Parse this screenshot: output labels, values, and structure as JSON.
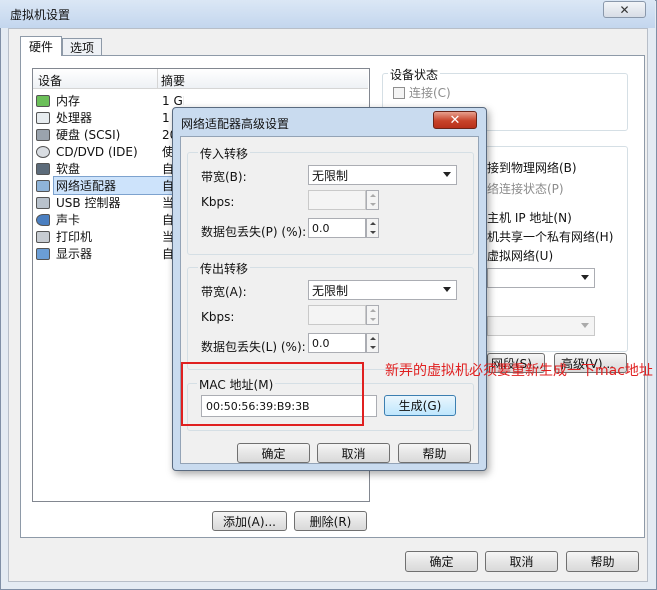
{
  "main": {
    "title": "虚拟机设置",
    "close_symbol": "✕",
    "tabs": [
      {
        "label": "硬件",
        "active": true
      },
      {
        "label": "选项",
        "active": false
      }
    ],
    "device_table": {
      "headers": [
        "设备",
        "摘要"
      ],
      "rows": [
        {
          "name": "内存",
          "icon": "memory-icon",
          "summary": "1 GB"
        },
        {
          "name": "处理器",
          "icon": "processor-icon",
          "summary": "1"
        },
        {
          "name": "硬盘 (SCSI)",
          "icon": "hard-disk-icon",
          "summary": "20"
        },
        {
          "name": "CD/DVD (IDE)",
          "icon": "cd-dvd-icon",
          "summary": "使"
        },
        {
          "name": "软盘",
          "icon": "floppy-icon",
          "summary": "自"
        },
        {
          "name": "网络适配器",
          "icon": "network-adapter-icon",
          "summary": "自",
          "selected": true
        },
        {
          "name": "USB 控制器",
          "icon": "usb-icon",
          "summary": "当"
        },
        {
          "name": "声卡",
          "icon": "sound-card-icon",
          "summary": "自"
        },
        {
          "name": "打印机",
          "icon": "printer-icon",
          "summary": "当"
        },
        {
          "name": "显示器",
          "icon": "display-icon",
          "summary": "自"
        }
      ]
    },
    "add_button": "添加(A)...",
    "remove_button": "删除(R)",
    "device_status": {
      "title": "设备状态",
      "connected": "连接(C)"
    },
    "network_options": {
      "bridged": "接到物理网络(B)",
      "replicate": "络连接状态(P)",
      "host_ip": "主机 IP 地址(N)",
      "host_only": "机共享一个私有网络(H)",
      "custom": "虚拟网络(U)"
    },
    "lan_segments_button": "网段(S)...",
    "advanced_button": "高级(V)...",
    "ok_button": "确定",
    "cancel_button": "取消",
    "help_button": "帮助"
  },
  "dialog": {
    "title": "网络适配器高级设置",
    "close_symbol": "✕",
    "incoming": {
      "title": "传入转移",
      "bandwidth_label": "带宽(B):",
      "bandwidth_value": "无限制",
      "kbps_label": "Kbps:",
      "kbps_value": "",
      "loss_label": "数据包丢失(P) (%):",
      "loss_value": "0.0"
    },
    "outgoing": {
      "title": "传出转移",
      "bandwidth_label": "带宽(A):",
      "bandwidth_value": "无限制",
      "kbps_label": "Kbps:",
      "kbps_value": "",
      "loss_label": "数据包丢失(L) (%):",
      "loss_value": "0.0"
    },
    "mac": {
      "label": "MAC 地址(M)",
      "value": "00:50:56:39:B9:3B",
      "generate_button": "生成(G)"
    },
    "ok_button": "确定",
    "cancel_button": "取消",
    "help_button": "帮助"
  },
  "annotation": {
    "text": "新弄的虚拟机必须要重新生成一下mac地址",
    "color": "#e02020"
  }
}
